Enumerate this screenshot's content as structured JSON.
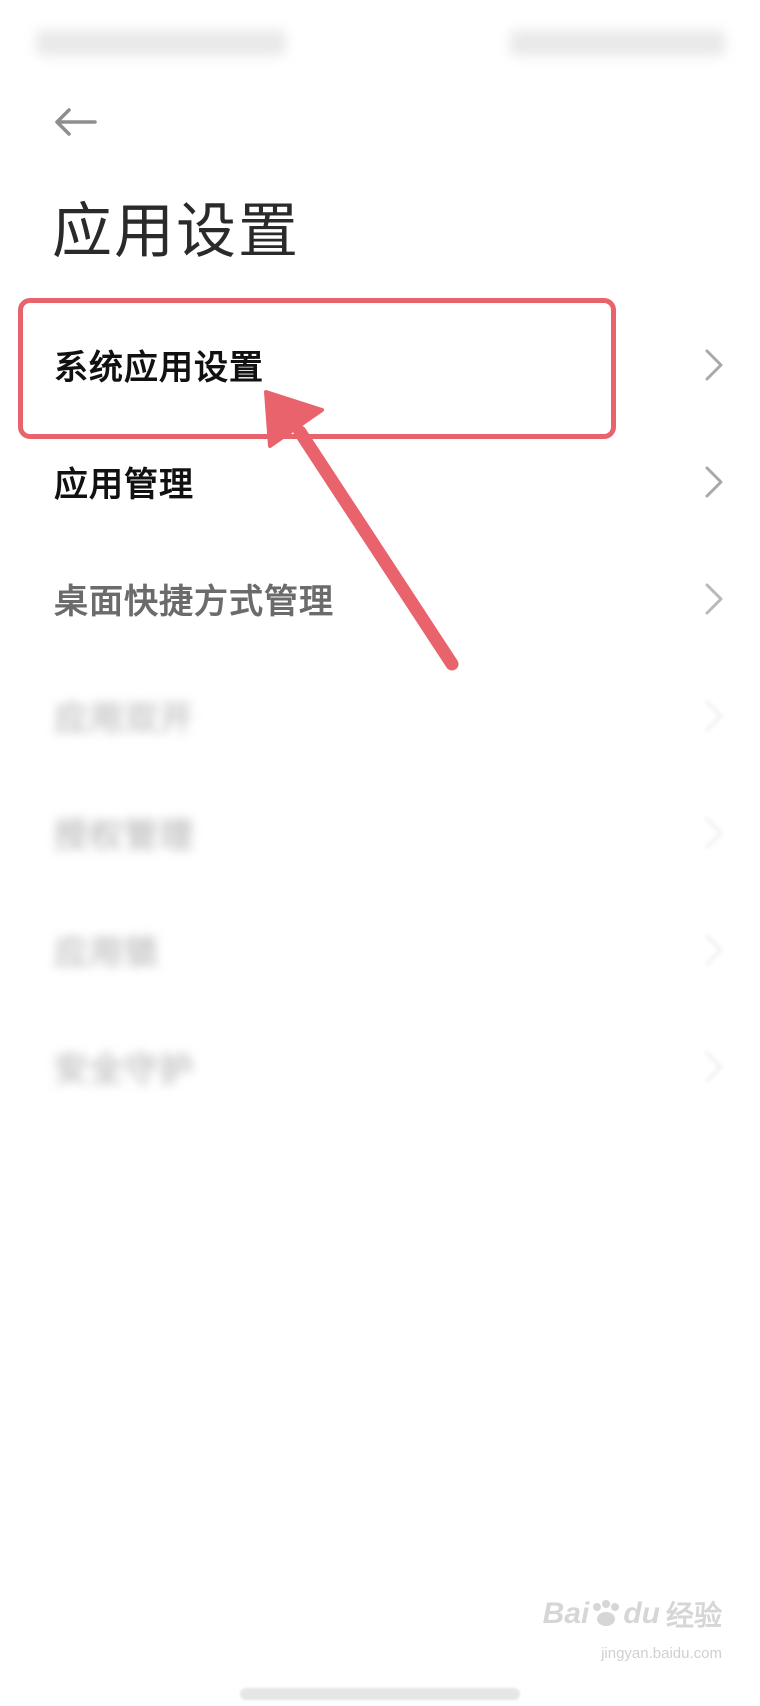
{
  "header": {
    "title": "应用设置"
  },
  "list": {
    "items": [
      {
        "label": "系统应用设置",
        "state": "highlighted"
      },
      {
        "label": "应用管理",
        "state": "normal"
      },
      {
        "label": "桌面快捷方式管理",
        "state": "faded"
      },
      {
        "label": "应用双开",
        "state": "blurred"
      },
      {
        "label": "授权管理",
        "state": "blurred"
      },
      {
        "label": "应用锁",
        "state": "blurred"
      },
      {
        "label": "安全守护",
        "state": "blurred"
      }
    ]
  },
  "annotation": {
    "color": "#e8636c"
  },
  "watermark": {
    "brand": "Bai",
    "brand_paw": "du",
    "brand_cn": "经验",
    "url": "jingyan.baidu.com"
  },
  "icons": {
    "back": "arrow-left-icon",
    "chevron": "chevron-right-icon"
  }
}
